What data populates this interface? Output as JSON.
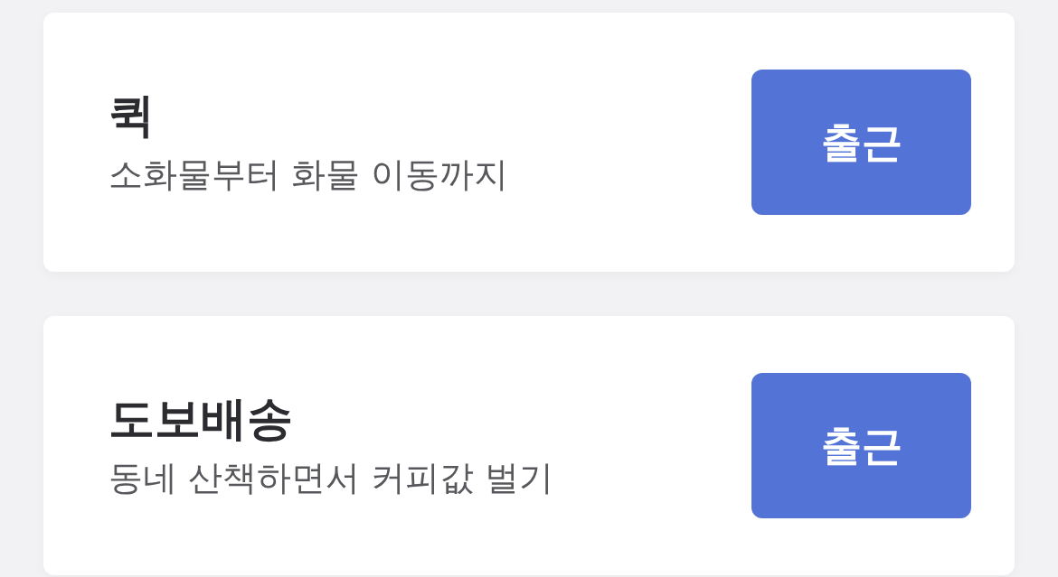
{
  "cards": [
    {
      "title": "퀵",
      "subtitle": "소화물부터 화물 이동까지",
      "button": "출근"
    },
    {
      "title": "도보배송",
      "subtitle": "동네 산책하면서 커피값 벌기",
      "button": "출근"
    }
  ]
}
